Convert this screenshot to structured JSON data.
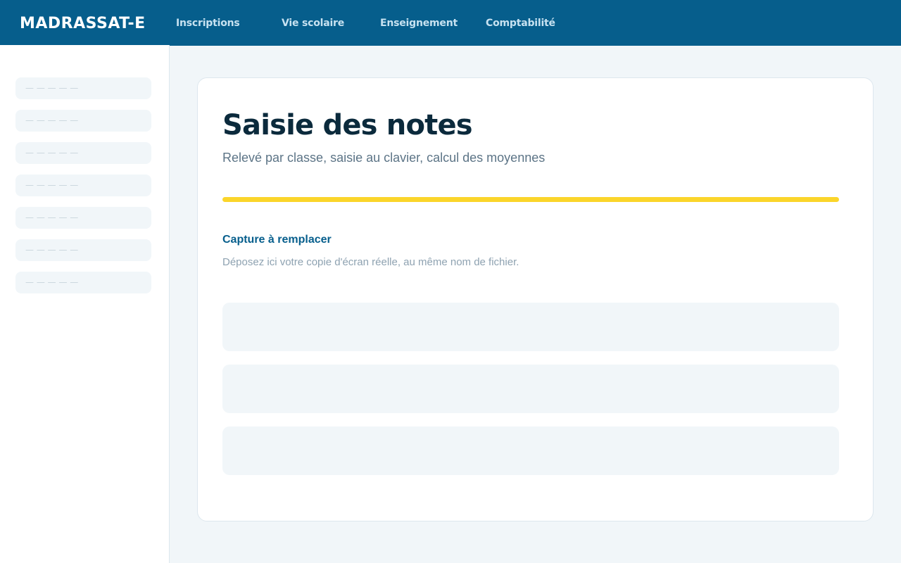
{
  "app": {
    "brand": "MADRASSAT-E"
  },
  "nav": {
    "items": [
      {
        "label": "Inscriptions"
      },
      {
        "label": "Vie scolaire"
      },
      {
        "label": "Enseignement"
      },
      {
        "label": "Comptabilité"
      }
    ]
  },
  "sidebar": {
    "items": [
      {
        "label": "— — — — —"
      },
      {
        "label": "— — — — —"
      },
      {
        "label": "— — — — —"
      },
      {
        "label": "— — — — —"
      },
      {
        "label": "— — — — —"
      },
      {
        "label": "— — — — —"
      },
      {
        "label": "— — — — —"
      }
    ]
  },
  "main": {
    "title": "Saisie des notes",
    "subtitle": "Relevé par classe, saisie au clavier, calcul des moyennes",
    "capture_title": "Capture à remplacer",
    "capture_desc": "Déposez ici votre copie d'écran réelle, au même nom de fichier."
  },
  "colors": {
    "topbar": "#065e8c",
    "accent": "#fbd52a",
    "title": "#0b2a3c",
    "background": "#f1f6f9"
  }
}
